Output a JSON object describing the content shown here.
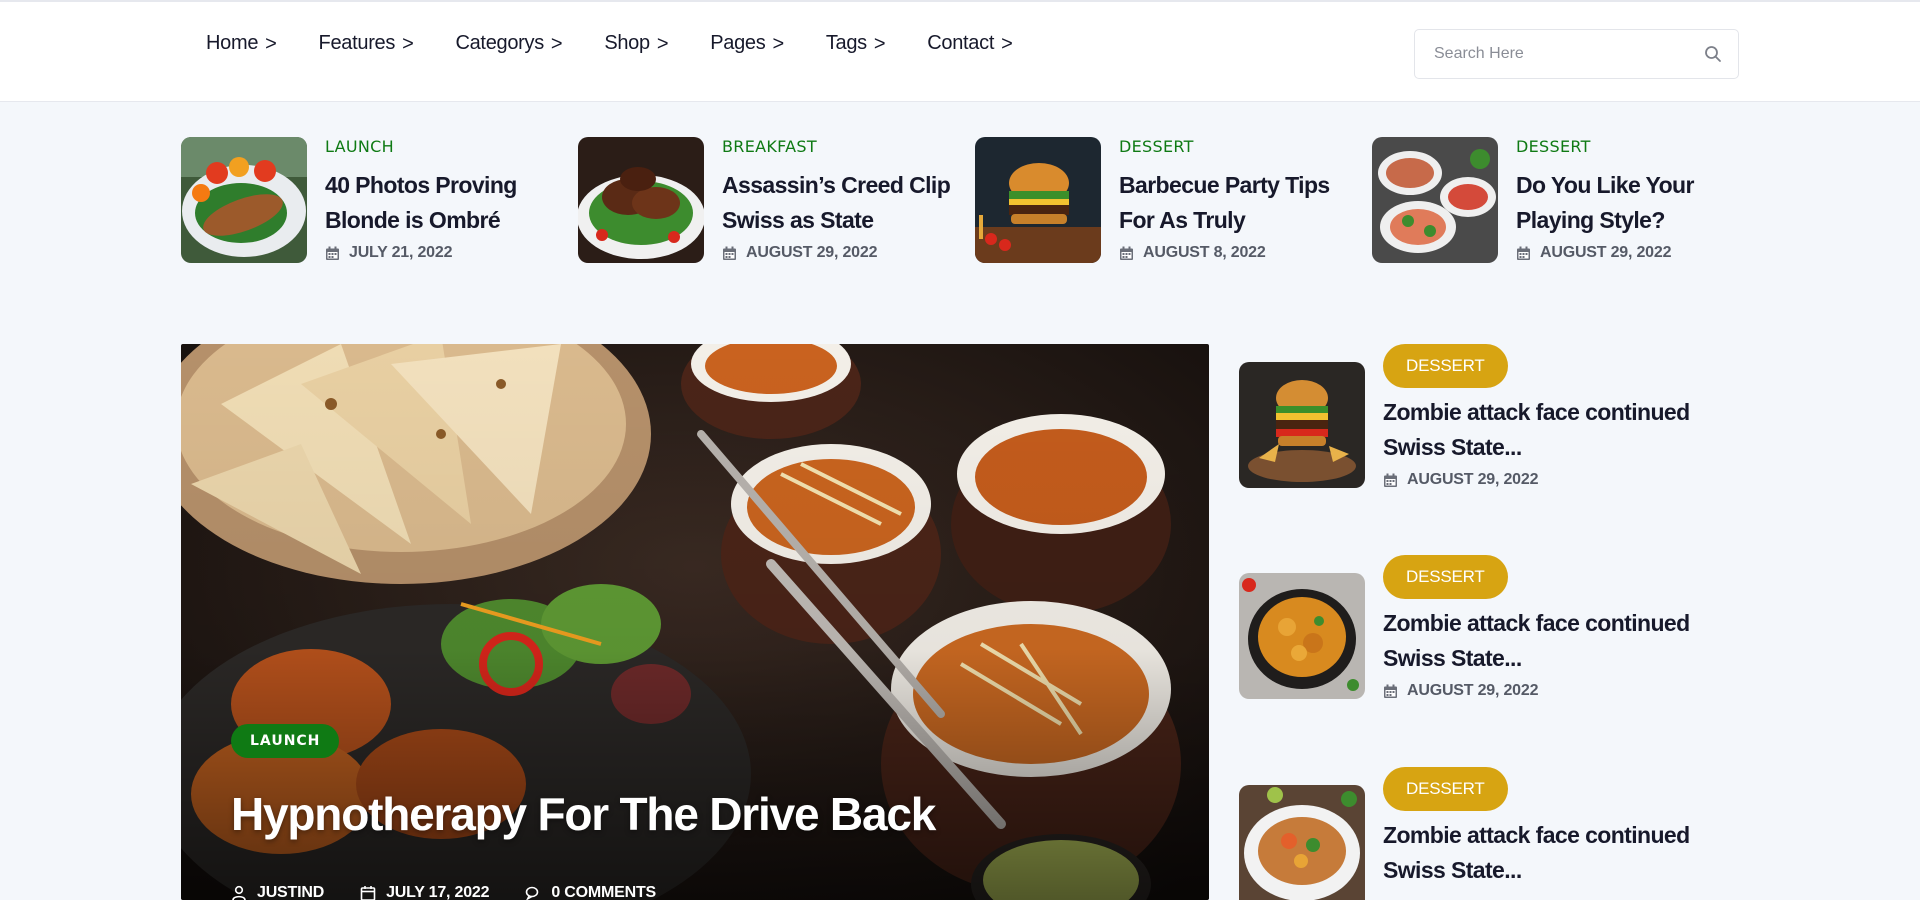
{
  "nav": {
    "items": [
      {
        "label": "Home"
      },
      {
        "label": "Features"
      },
      {
        "label": "Categorys"
      },
      {
        "label": "Shop"
      },
      {
        "label": "Pages"
      },
      {
        "label": "Tags"
      },
      {
        "label": "Contact"
      }
    ],
    "chevron": ">"
  },
  "search": {
    "placeholder": "Search Here",
    "icon": "search-icon"
  },
  "strip": [
    {
      "category": "LAUNCH",
      "title": "40 Photos Proving Blonde is Ombré",
      "date": "JULY 21, 2022"
    },
    {
      "category": "BREAKFAST",
      "title": "Assassin’s Creed Clip Swiss as State",
      "date": "AUGUST 29, 2022"
    },
    {
      "category": "DESSERT",
      "title": "Barbecue Party Tips For As Truly",
      "date": "AUGUST 8, 2022"
    },
    {
      "category": "DESSERT",
      "title": "Do You Like Your Playing Style?",
      "date": "AUGUST 29, 2022"
    }
  ],
  "hero": {
    "category": "LAUNCH",
    "title": "Hypnotherapy For The Drive Back",
    "author": "JUSTIND",
    "date": "JULY 17, 2022",
    "comments": "0 COMMENTS"
  },
  "sidebar": [
    {
      "category": "DESSERT",
      "title": "Zombie attack face continued Swiss State...",
      "date": "AUGUST 29, 2022"
    },
    {
      "category": "DESSERT",
      "title": "Zombie attack face continued Swiss State...",
      "date": "AUGUST 29, 2022"
    },
    {
      "category": "DESSERT",
      "title": "Zombie attack face continued Swiss State...",
      "date": ""
    }
  ],
  "colors": {
    "accent_green": "#0f7a14",
    "accent_gold": "#d7a412",
    "text_dark": "#17192b",
    "page_bg": "#f4f7fb"
  }
}
